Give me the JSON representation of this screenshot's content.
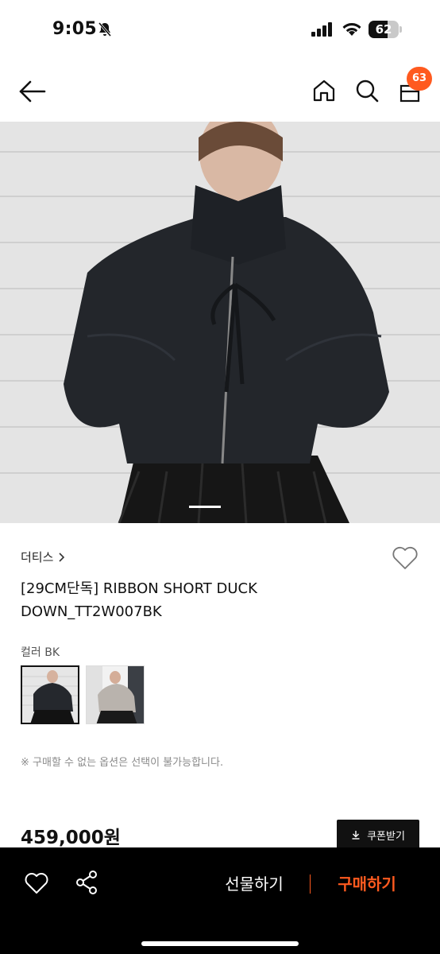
{
  "status": {
    "time": "9:05",
    "battery": "62",
    "battery_level": 0.62
  },
  "header": {
    "cart_count": "63"
  },
  "product": {
    "brand": "더티스",
    "title": "[29CM단독] RIBBON SHORT DUCK DOWN_TT2W007BK",
    "color_label": "컬러 BK",
    "notice": "※ 구매할 수 없는 옵션은 선택이 불가능합니다.",
    "price": "459,000원",
    "coupon_label": "쿠폰받기"
  },
  "bottom": {
    "gift_label": "선물하기",
    "buy_label": "구매하기"
  },
  "colors": {
    "accent": "#ff5a1f",
    "bar": "#000000"
  },
  "icons": [
    "bell-slash-icon",
    "signal-icon",
    "wifi-icon",
    "battery-icon",
    "back-arrow-icon",
    "home-icon",
    "search-icon",
    "bag-icon",
    "chevron-right-icon",
    "heart-icon",
    "download-icon",
    "share-icon"
  ]
}
